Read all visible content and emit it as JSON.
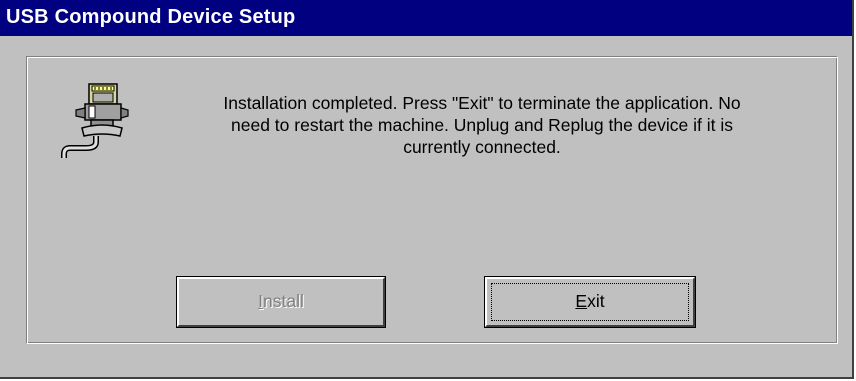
{
  "window": {
    "title": "USB Compound Device Setup"
  },
  "message": {
    "text": "Installation completed. Press \"Exit\" to terminate the application. No\nneed to restart the machine. Unplug and Replug the device if it is\ncurrently connected."
  },
  "buttons": {
    "install": {
      "mnemonic": "I",
      "rest": "nstall",
      "enabled": false
    },
    "exit": {
      "mnemonic": "E",
      "rest": "xit",
      "enabled": true,
      "focused": true
    }
  },
  "icons": {
    "main": "usb-device-icon"
  }
}
